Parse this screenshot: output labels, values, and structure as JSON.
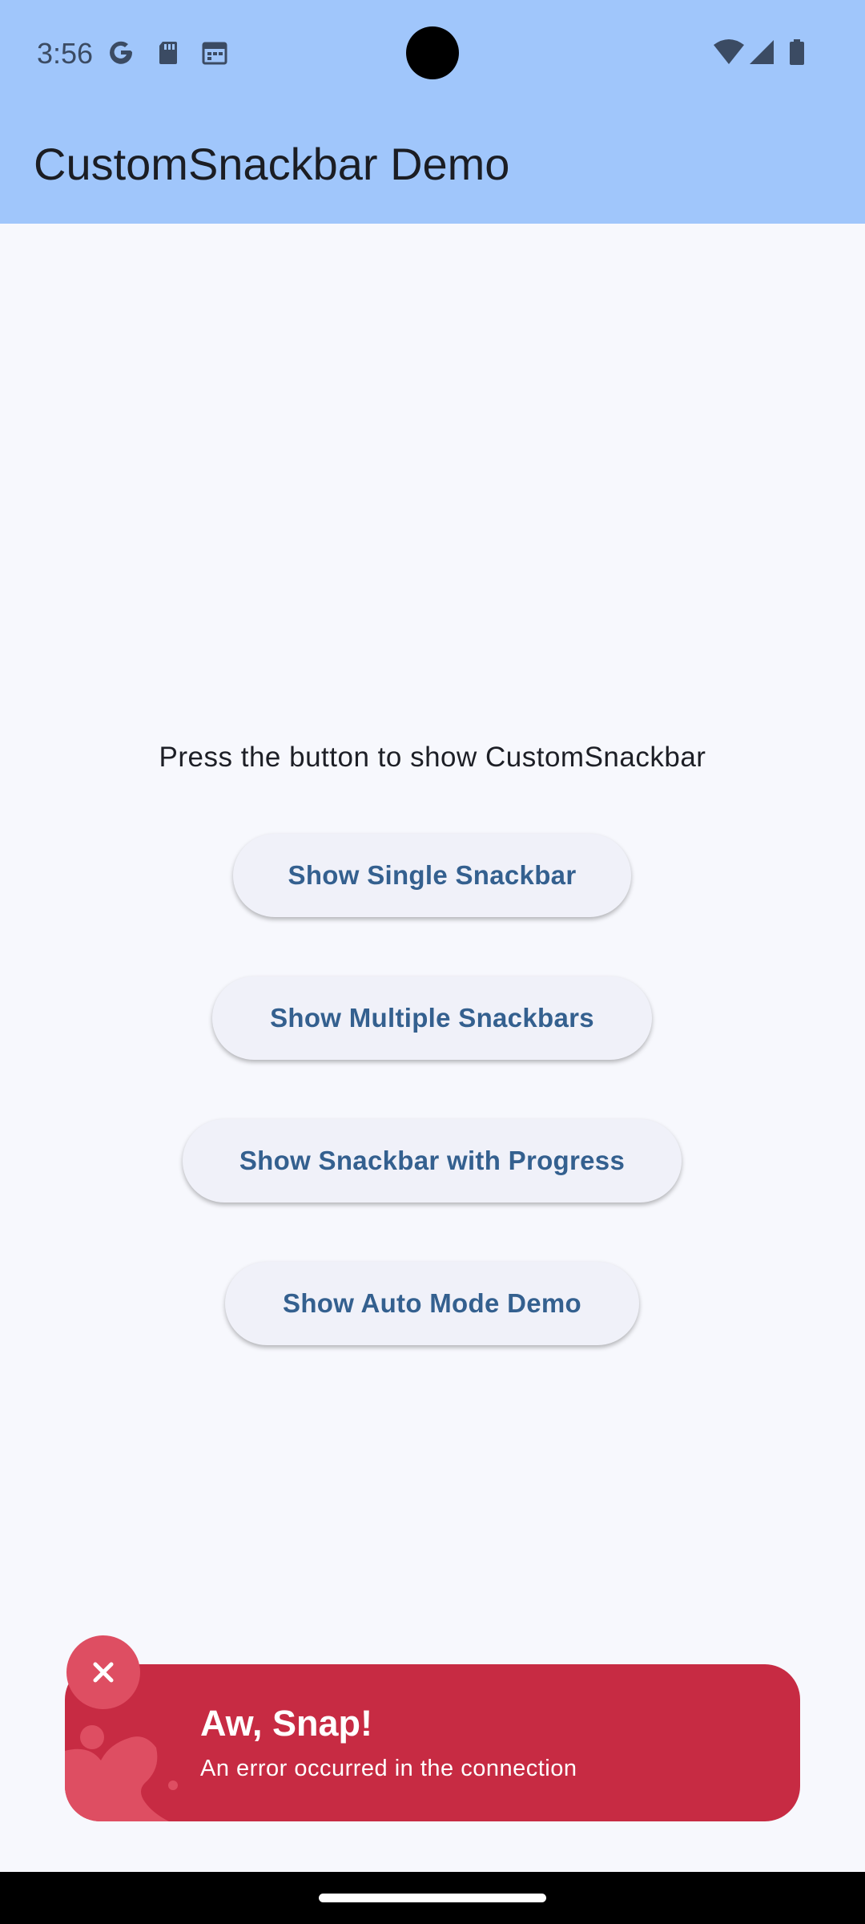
{
  "status_bar": {
    "time": "3:56",
    "left_icons": [
      "google-icon",
      "sd-card-icon",
      "calendar-icon"
    ],
    "right_icons": [
      "wifi-icon",
      "cell-signal-icon",
      "battery-icon"
    ]
  },
  "app_bar": {
    "title": "CustomSnackbar Demo",
    "color": "#a0c6fb"
  },
  "main": {
    "prompt": "Press the button to show CustomSnackbar",
    "buttons": [
      {
        "label": "Show Single Snackbar"
      },
      {
        "label": "Show Multiple Snackbars"
      },
      {
        "label": "Show Snackbar with Progress"
      },
      {
        "label": "Show Auto Mode Demo"
      }
    ]
  },
  "snackbar": {
    "title": "Aw, Snap!",
    "message": "An error occurred in the connection",
    "color": "#c72b43",
    "icon": "close-icon"
  },
  "colors": {
    "background": "#f7f8fd",
    "button_text": "#34608f",
    "button_bg": "#f0f1f9"
  }
}
